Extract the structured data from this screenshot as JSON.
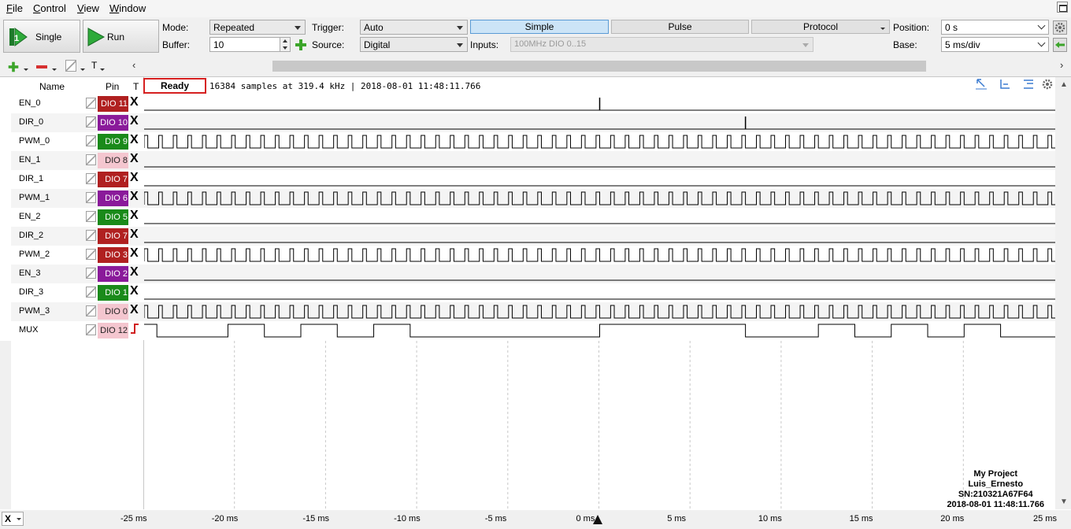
{
  "menu": [
    "File",
    "Control",
    "View",
    "Window"
  ],
  "toolbar": {
    "single_label": "Single",
    "run_label": "Run",
    "mode_label": "Mode:",
    "mode_value": "Repeated",
    "buffer_label": "Buffer:",
    "buffer_value": "10",
    "trigger_label": "Trigger:",
    "trigger_value": "Auto",
    "source_label": "Source:",
    "source_value": "Digital",
    "inputs_label": "Inputs:",
    "inputs_value": "100MHz DIO 0..15",
    "tabs": [
      "Simple",
      "Pulse",
      "Protocol"
    ],
    "active_tab": "Simple",
    "position_label": "Position:",
    "position_value": "0 s",
    "base_label": "Base:",
    "base_value": "5 ms/div"
  },
  "table_header": {
    "name": "Name",
    "pin": "Pin",
    "trigger": "T"
  },
  "status": {
    "state": "Ready",
    "info": "16384 samples at 319.4 kHz | 2018-08-01 11:48:11.766"
  },
  "signals": [
    {
      "name": "EN_0",
      "pin": "DIO 11",
      "color": "#b02020",
      "trigger": "X",
      "wave": "en0"
    },
    {
      "name": "DIR_0",
      "pin": "DIO 10",
      "color": "#8a1a9a",
      "trigger": "X",
      "wave": "dir0"
    },
    {
      "name": "PWM_0",
      "pin": "DIO 9",
      "color": "#1a8a1a",
      "trigger": "X",
      "wave": "pwm"
    },
    {
      "name": "EN_1",
      "pin": "DIO 8",
      "color": "#f4c6cf",
      "trigger": "X",
      "wave": "low"
    },
    {
      "name": "DIR_1",
      "pin": "DIO 7",
      "color": "#b02020",
      "trigger": "X",
      "wave": "low"
    },
    {
      "name": "PWM_1",
      "pin": "DIO 6",
      "color": "#8a1a9a",
      "trigger": "X",
      "wave": "pwm"
    },
    {
      "name": "EN_2",
      "pin": "DIO 5",
      "color": "#1a8a1a",
      "trigger": "X",
      "wave": "low"
    },
    {
      "name": "DIR_2",
      "pin": "DIO 7",
      "color": "#b02020",
      "trigger": "X",
      "wave": "low"
    },
    {
      "name": "PWM_2",
      "pin": "DIO 3",
      "color": "#b02020",
      "trigger": "X",
      "wave": "pwm"
    },
    {
      "name": "EN_3",
      "pin": "DIO 2",
      "color": "#8a1a9a",
      "trigger": "X",
      "wave": "low"
    },
    {
      "name": "DIR_3",
      "pin": "DIO 1",
      "color": "#1a8a1a",
      "trigger": "X",
      "wave": "low"
    },
    {
      "name": "PWM_3",
      "pin": "DIO 0",
      "color": "#f4c6cf",
      "trigger": "X",
      "wave": "pwm"
    },
    {
      "name": "MUX",
      "pin": "DIO 12",
      "color": "#f4c6cf",
      "trigger": "rising-edge",
      "wave": "mux"
    }
  ],
  "mux_edges_ms": [
    -24.3,
    -20.4,
    -18.4,
    -16.4,
    -14.4,
    -12.4,
    -10.4,
    0,
    8,
    12,
    14,
    16,
    18,
    20,
    22
  ],
  "axis": {
    "ticks": [
      "-25 ms",
      "-20 ms",
      "-15 ms",
      "-10 ms",
      "-5 ms",
      "0 ms",
      "5 ms",
      "10 ms",
      "15 ms",
      "20 ms",
      "25 ms"
    ],
    "min_ms": -25,
    "max_ms": 25,
    "cursor_ms": 0
  },
  "project": {
    "title": "My Project",
    "user": "Luis_Ernesto",
    "serial": "SN:210321A67F64",
    "timestamp": "2018-08-01 11:48:11.766"
  },
  "icons": [
    "single-run-icon",
    "run-play-icon",
    "add-channel-icon",
    "remove-channel-icon",
    "edit-icon",
    "text-icon",
    "zoom-icon",
    "settings-gear-icon"
  ]
}
